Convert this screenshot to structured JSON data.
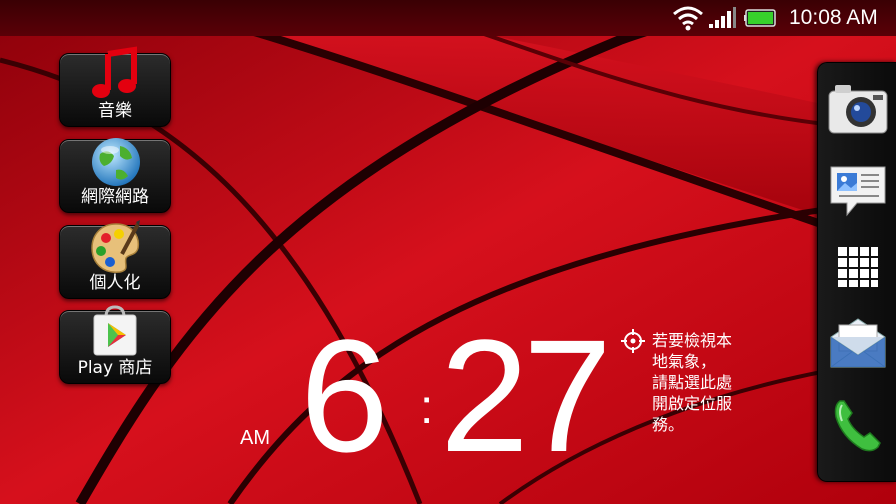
{
  "status_bar": {
    "wifi_icon": "wifi-icon",
    "signal_icon": "cell-signal-icon",
    "battery_icon": "battery-icon",
    "time": "10:08 AM"
  },
  "apps": [
    {
      "name": "music",
      "label": "音樂",
      "icon": "music-note-icon"
    },
    {
      "name": "internet",
      "label": "網際網路",
      "icon": "globe-icon"
    },
    {
      "name": "personalize",
      "label": "個人化",
      "icon": "palette-icon"
    },
    {
      "name": "play-store",
      "label": "Play 商店",
      "icon": "play-store-icon"
    }
  ],
  "dock": [
    {
      "name": "camera",
      "icon": "camera-icon"
    },
    {
      "name": "messages",
      "icon": "message-icon"
    },
    {
      "name": "all-apps",
      "icon": "app-grid-icon"
    },
    {
      "name": "mail",
      "icon": "mail-icon"
    },
    {
      "name": "phone",
      "icon": "phone-icon"
    }
  ],
  "clock": {
    "hour": "6",
    "colon": ":",
    "minutes": "27",
    "ampm": "AM"
  },
  "weather": {
    "icon": "location-target-icon",
    "message": "若要檢視本\n地氣象，\n請點選此處\n開啟定位服\n務。"
  },
  "colors": {
    "wallpaper_red": "#c8000e",
    "wallpaper_dark": "#4a0004",
    "battery_green": "#37d12b"
  }
}
